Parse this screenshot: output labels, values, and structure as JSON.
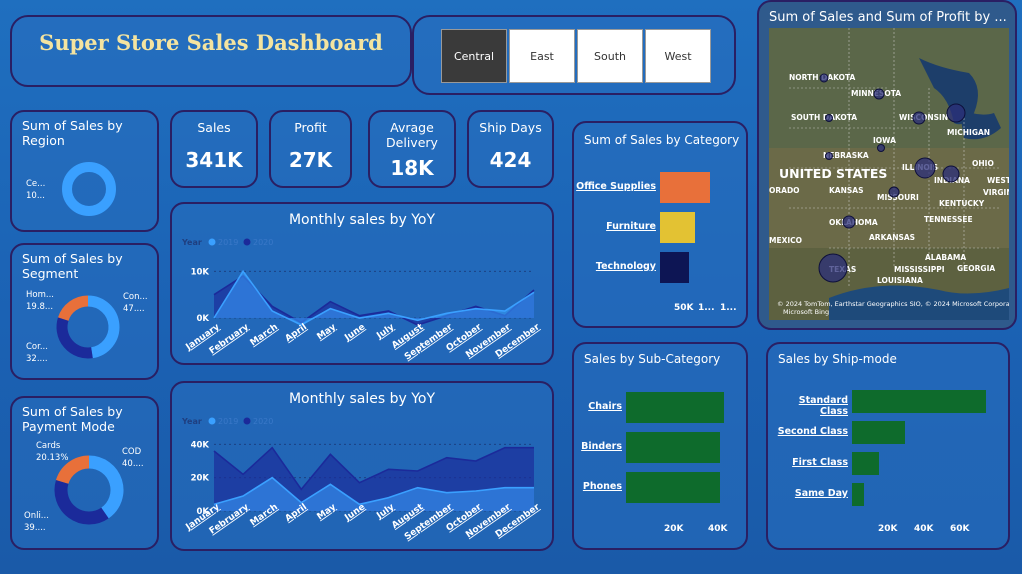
{
  "header": {
    "title": "Super Store Sales Dashboard"
  },
  "region_slicer": {
    "options": [
      "Central",
      "East",
      "South",
      "West"
    ],
    "selected": "Central"
  },
  "colors": {
    "background": "#1f6fbf",
    "card_border": "#2a1f63",
    "title_gold": "#f4e4a0",
    "light_blue": "#3aa0ff",
    "dark_blue": "#1b2a9a",
    "orange": "#e8703a",
    "yellow": "#e3c233",
    "navy": "#0d1554",
    "green": "#0e6b2c"
  },
  "kpis": {
    "sales": {
      "label": "Sales",
      "value": "341K"
    },
    "profit": {
      "label": "Profit",
      "value": "27K"
    },
    "avg_delivery": {
      "label": "Avrage Delivery",
      "value": "18K"
    },
    "ship_days": {
      "label": "Ship Days",
      "value": "424"
    }
  },
  "region_chart": {
    "title": "Sum of Sales by Region",
    "labels": [
      "Ce...",
      "10..."
    ],
    "chart_data": {
      "type": "pie",
      "categories": [
        "Central"
      ],
      "values": [
        100
      ]
    }
  },
  "segment_chart": {
    "title": "Sum of Sales by Segment",
    "labels": {
      "home": "Hom...",
      "home_val": "19.8...",
      "consumer": "Con...",
      "consumer_val": "47....",
      "corporate": "Cor...",
      "corporate_val": "32...."
    },
    "chart_data": {
      "type": "pie",
      "categories": [
        "Home Office",
        "Consumer",
        "Corporate"
      ],
      "values": [
        19.8,
        47.0,
        32.0
      ]
    }
  },
  "payment_chart": {
    "title": "Sum of Sales by Payment Mode",
    "labels": {
      "cards": "Cards",
      "cards_val": "20.13%",
      "cod": "COD",
      "cod_val": "40....",
      "online": "Onli...",
      "online_val": "39...."
    },
    "chart_data": {
      "type": "pie",
      "categories": [
        "Cards",
        "COD",
        "Online"
      ],
      "values": [
        20.13,
        40.0,
        39.0
      ]
    }
  },
  "monthly_profit": {
    "title": "Monthly sales by YoY",
    "legend": {
      "label": "Year",
      "series_a": "2019",
      "series_b": "2020"
    },
    "chart_data": {
      "type": "area",
      "categories": [
        "January",
        "February",
        "March",
        "April",
        "May",
        "June",
        "July",
        "August",
        "September",
        "October",
        "November",
        "December"
      ],
      "series": [
        {
          "name": "2019",
          "values": [
            0,
            10000,
            1500,
            -1500,
            2000,
            0,
            1000,
            -500,
            1000,
            2000,
            1500,
            5500
          ]
        },
        {
          "name": "2020",
          "values": [
            5000,
            9000,
            2500,
            -1000,
            3500,
            500,
            1500,
            -1500,
            500,
            2500,
            500,
            6000
          ]
        }
      ],
      "yticks": [
        "10K",
        "0K"
      ],
      "ylim": [
        -3000,
        12000
      ]
    }
  },
  "monthly_sales": {
    "title": "Monthly sales by YoY",
    "legend": {
      "label": "Year",
      "series_a": "2019",
      "series_b": "2020"
    },
    "chart_data": {
      "type": "area",
      "categories": [
        "January",
        "February",
        "March",
        "April",
        "May",
        "June",
        "July",
        "August",
        "September",
        "October",
        "November",
        "December"
      ],
      "series": [
        {
          "name": "2019",
          "values": [
            4000,
            9000,
            20000,
            5000,
            16000,
            4000,
            8000,
            14000,
            11000,
            12000,
            14000,
            14000
          ]
        },
        {
          "name": "2020",
          "values": [
            36000,
            22000,
            38000,
            13000,
            34000,
            17000,
            25000,
            24000,
            32000,
            30000,
            38000,
            38000
          ]
        }
      ],
      "yticks": [
        "40K",
        "20K",
        "0K"
      ],
      "ylim": [
        0,
        42000
      ]
    }
  },
  "category_chart": {
    "title": "Sum of Sales by Category",
    "chart_data": {
      "type": "bar",
      "categories": [
        "Office Supplies",
        "Furniture",
        "Technology"
      ],
      "values": [
        120000,
        85000,
        70000
      ],
      "xticks": [
        "50K",
        "1...",
        "1..."
      ],
      "xlim": [
        0,
        130000
      ]
    }
  },
  "map": {
    "title": "Sum of Sales and Sum of Profit by ...",
    "country_label": "UNITED STATES",
    "state_labels": [
      "NORTH DAKOTA",
      "MINNESOTA",
      "SOUTH DAKOTA",
      "WISCONSIN",
      "MICHIGAN",
      "IOWA",
      "NEBRASKA",
      "ILLINOIS",
      "INDIANA",
      "OHIO",
      "KANSAS",
      "MISSOURI",
      "KENTUCKY",
      "VIRGINIA",
      "OKLAHOMA",
      "TENNESSEE",
      "ARKANSAS",
      "MEXICO",
      "ALABAMA",
      "GEORGIA",
      "TEXAS",
      "MISSISSIPPI",
      "LOUISIANA",
      "WEST VIRG",
      "ORADO"
    ],
    "attribution": "© 2024 TomTom, Earthstar Geographics SIO, © 2024 Microsoft Corporation",
    "bing_label": "Microsoft Bing"
  },
  "subcategory_chart": {
    "title": "Sales by Sub-Category",
    "chart_data": {
      "type": "bar",
      "categories": [
        "Chairs",
        "Binders",
        "Phones"
      ],
      "values": [
        46000,
        44000,
        44000
      ],
      "xticks": [
        "20K",
        "40K"
      ],
      "xlim": [
        0,
        48000
      ]
    }
  },
  "shipmode_chart": {
    "title": "Sales by Ship-mode",
    "chart_data": {
      "type": "bar",
      "categories": [
        "Standard Class",
        "Second Class",
        "First Class",
        "Same Day"
      ],
      "values": [
        80000,
        32000,
        16000,
        7000
      ],
      "xticks": [
        "20K",
        "40K",
        "60K"
      ],
      "xlim": [
        0,
        85000
      ]
    }
  }
}
